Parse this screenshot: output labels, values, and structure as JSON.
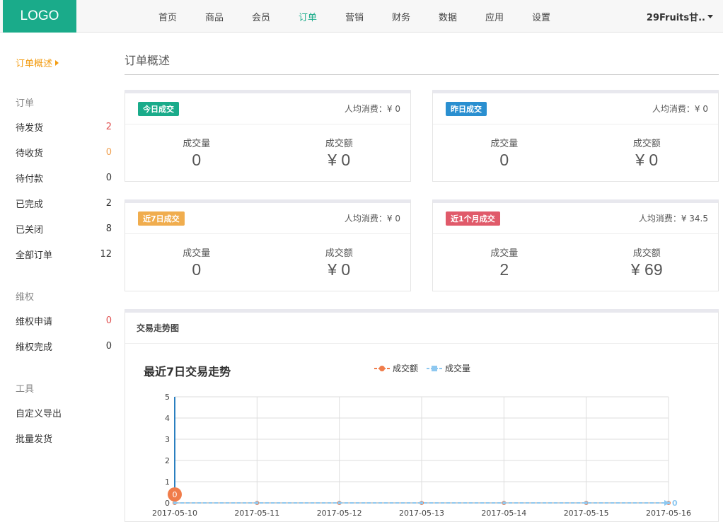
{
  "header": {
    "logo": "LOGO",
    "nav": [
      "首页",
      "商品",
      "会员",
      "订单",
      "营销",
      "财务",
      "数据",
      "应用",
      "设置"
    ],
    "active_nav": "订单",
    "user": "29Fruits甘.."
  },
  "sidebar": {
    "current": "订单概述",
    "sections": [
      {
        "title": "订单",
        "items": [
          {
            "label": "待发货",
            "count": "2",
            "color": "red"
          },
          {
            "label": "待收货",
            "count": "0",
            "color": "orange"
          },
          {
            "label": "待付款",
            "count": "0",
            "color": "normal"
          },
          {
            "label": "已完成",
            "count": "2",
            "color": "normal"
          },
          {
            "label": "已关闭",
            "count": "8",
            "color": "normal"
          },
          {
            "label": "全部订单",
            "count": "12",
            "color": "normal"
          }
        ]
      },
      {
        "title": "维权",
        "items": [
          {
            "label": "维权申请",
            "count": "0",
            "color": "red"
          },
          {
            "label": "维权完成",
            "count": "0",
            "color": "normal"
          }
        ]
      },
      {
        "title": "工具",
        "items": [
          {
            "label": "自定义导出",
            "count": "",
            "color": "normal"
          },
          {
            "label": "批量发货",
            "count": "",
            "color": "normal"
          }
        ]
      }
    ]
  },
  "main": {
    "title": "订单概述",
    "cards": [
      {
        "badge": "今日成交",
        "badge_color": "#1aab8a",
        "avg": "人均消费：¥ 0",
        "qty_label": "成交量",
        "qty": "0",
        "amt_label": "成交额",
        "amt": "¥ 0"
      },
      {
        "badge": "昨日成交",
        "badge_color": "#2a8fd0",
        "avg": "人均消费：¥ 0",
        "qty_label": "成交量",
        "qty": "0",
        "amt_label": "成交额",
        "amt": "¥ 0"
      },
      {
        "badge": "近7日成交",
        "badge_color": "#f0ad4e",
        "avg": "人均消费：¥ 0",
        "qty_label": "成交量",
        "qty": "0",
        "amt_label": "成交额",
        "amt": "¥ 0"
      },
      {
        "badge": "近1个月成交",
        "badge_color": "#e05a6a",
        "avg": "人均消费：¥ 34.5",
        "qty_label": "成交量",
        "qty": "2",
        "amt_label": "成交额",
        "amt": "¥ 69"
      }
    ],
    "trend_panel_title": "交易走势图"
  },
  "chart_data": {
    "type": "line",
    "title": "最近7日交易走势",
    "categories": [
      "2017-05-10",
      "2017-05-11",
      "2017-05-12",
      "2017-05-13",
      "2017-05-14",
      "2017-05-15",
      "2017-05-16"
    ],
    "series": [
      {
        "name": "成交额",
        "values": [
          0,
          0,
          0,
          0,
          0,
          0,
          0
        ],
        "color": "#f07c4a"
      },
      {
        "name": "成交量",
        "values": [
          0,
          0,
          0,
          0,
          0,
          0,
          0
        ],
        "color": "#8ec8f0"
      }
    ],
    "ylim": [
      0,
      5
    ],
    "yticks": [
      "0",
      "1",
      "2",
      "3",
      "4",
      "5"
    ],
    "point_labels": {
      "first": "0",
      "last": "0"
    },
    "legend_position": "top",
    "grid": true
  }
}
